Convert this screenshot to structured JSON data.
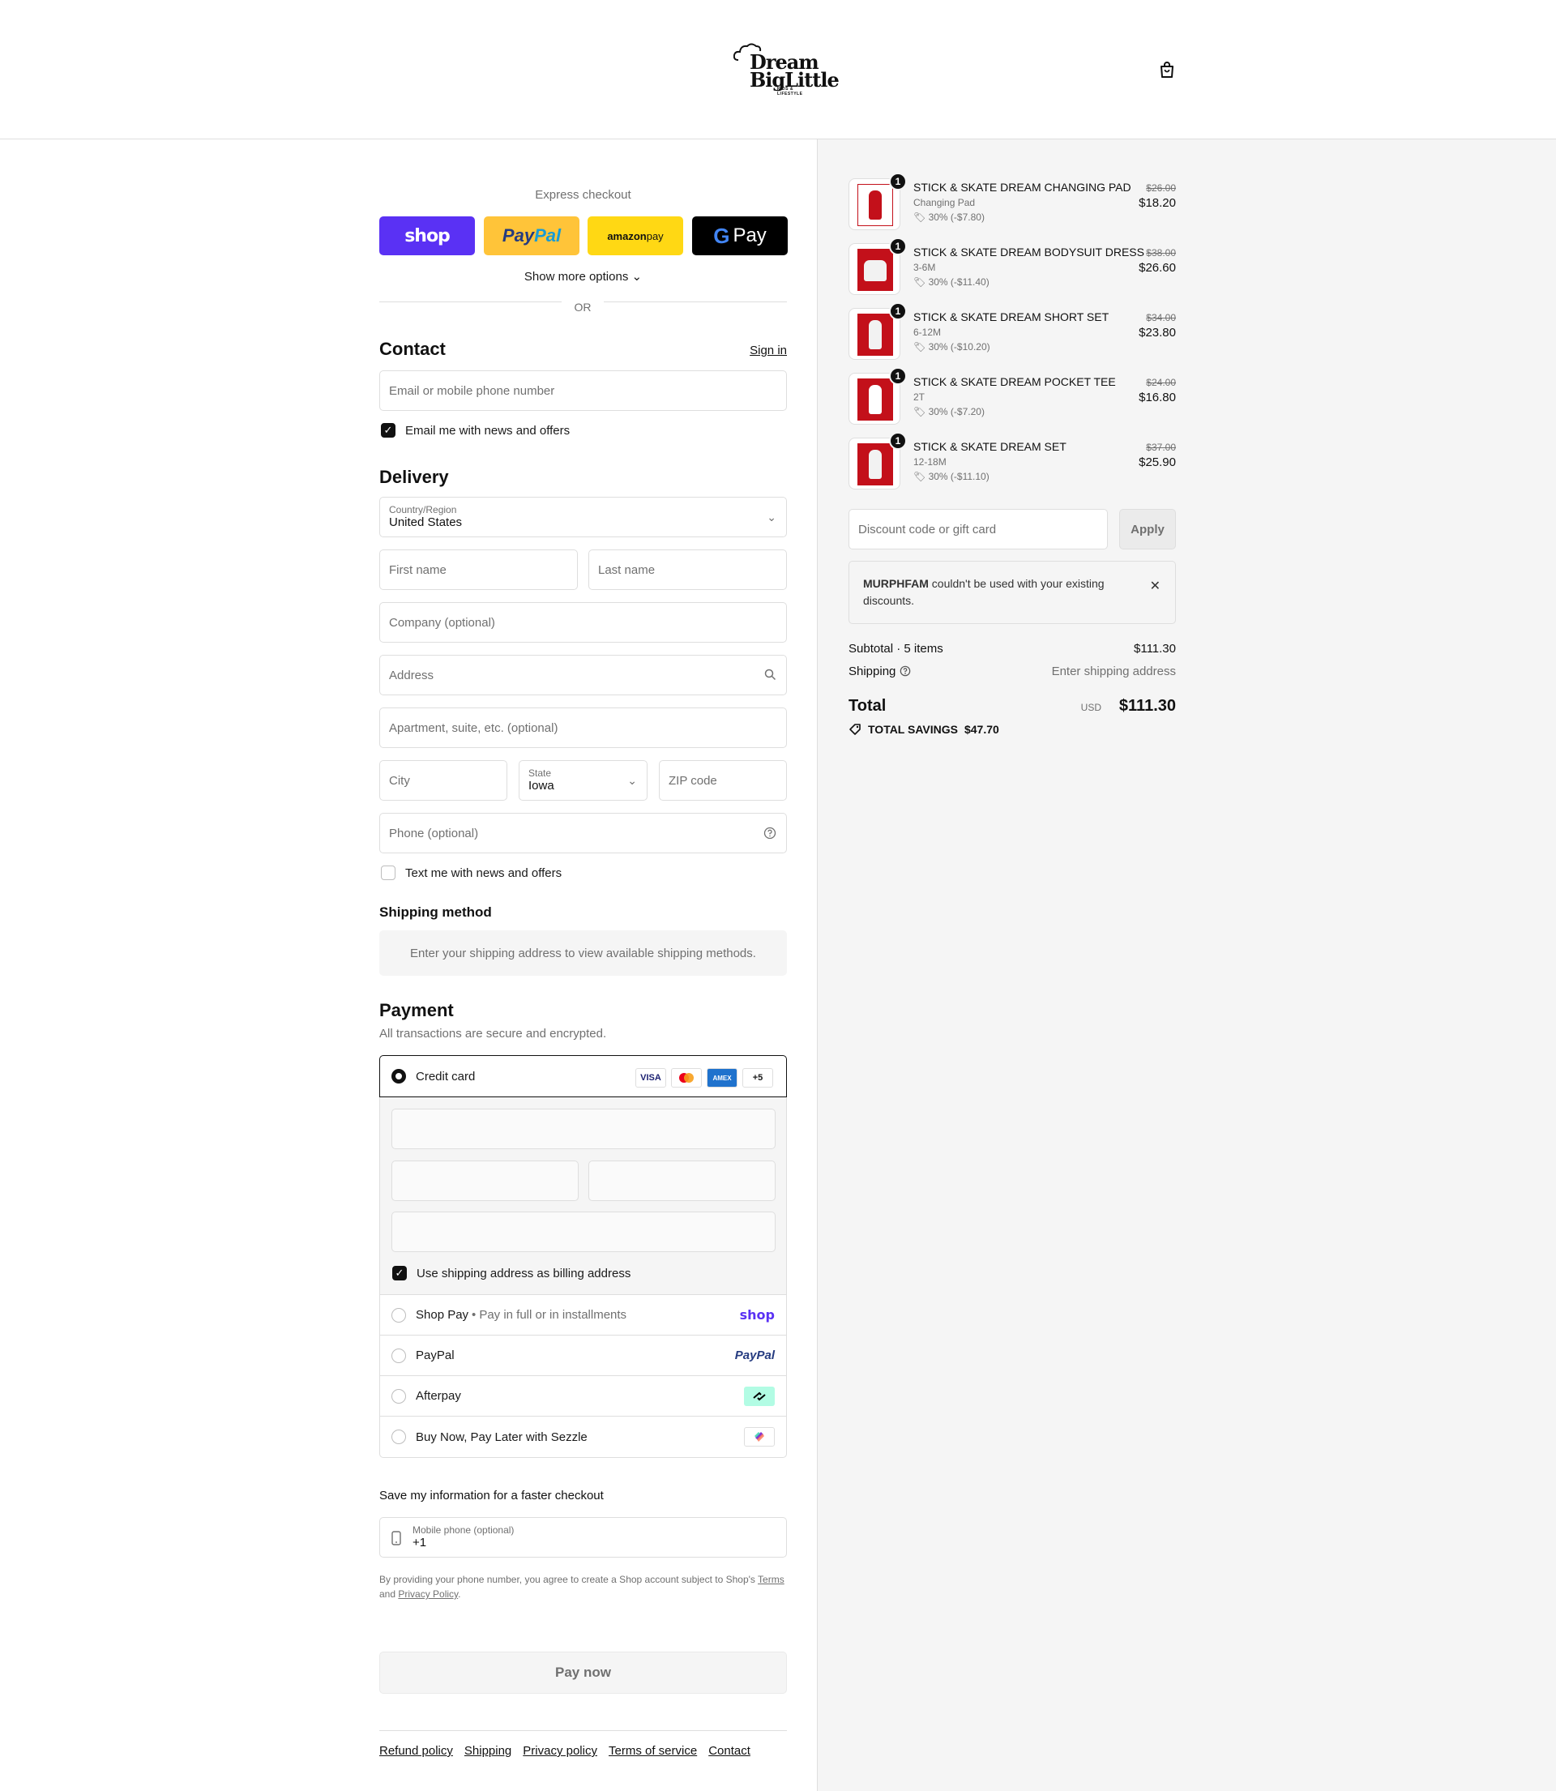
{
  "brand": {
    "logo_line1": "Dream",
    "logo_line2": "BigLittle",
    "logo_tagline": "KIDS & LIFESTYLE"
  },
  "express": {
    "title": "Express checkout",
    "shop_label": "shop",
    "paypal_label_a": "Pay",
    "paypal_label_b": "Pal",
    "amazon_label_a": "amazon",
    "amazon_label_b": " pay",
    "gpay_label": "Pay",
    "more_options": "Show more options",
    "or": "OR"
  },
  "contact": {
    "heading": "Contact",
    "sign_in": "Sign in",
    "email_placeholder": "Email or mobile phone number",
    "email_news": "Email me with news and offers"
  },
  "delivery": {
    "heading": "Delivery",
    "country_label": "Country/Region",
    "country_value": "United States",
    "first_name": "First name",
    "last_name": "Last name",
    "company": "Company (optional)",
    "address": "Address",
    "apartment": "Apartment, suite, etc. (optional)",
    "city": "City",
    "state_label": "State",
    "state_value": "Iowa",
    "zip": "ZIP code",
    "phone": "Phone (optional)",
    "text_news": "Text me with news and offers"
  },
  "shipping_method": {
    "heading": "Shipping method",
    "info": "Enter your shipping address to view available shipping methods."
  },
  "payment": {
    "heading": "Payment",
    "subtitle": "All transactions are secure and encrypted.",
    "credit_card": "Credit card",
    "card_more": "+5",
    "card_visa": "VISA",
    "card_amex": "AMEX",
    "billing_same": "Use shipping address as billing address",
    "shop_pay": "Shop Pay",
    "shop_pay_sub": "Pay in full or in installments",
    "shop_pay_logo": "shop",
    "paypal": "PayPal",
    "paypal_logo": "PayPal",
    "afterpay": "Afterpay",
    "sezzle": "Buy Now, Pay Later with Sezzle"
  },
  "save_info": {
    "title": "Save my information for a faster checkout",
    "phone_label": "Mobile phone (optional)",
    "phone_value": "+1",
    "legal_pre": "By providing your phone number, you agree to create a Shop account subject to Shop's",
    "legal_terms": "Terms",
    "legal_and": "and",
    "legal_privacy": "Privacy Policy",
    "legal_end": "."
  },
  "pay_now": "Pay now",
  "footer": [
    "Refund policy",
    "Shipping",
    "Privacy policy",
    "Terms of service",
    "Contact"
  ],
  "cart": {
    "items": [
      {
        "qty": "1",
        "name": "STICK & SKATE DREAM CHANGING PAD",
        "variant": "Changing Pad",
        "discount": "30% (-$7.80)",
        "original": "$26.00",
        "price": "$18.20"
      },
      {
        "qty": "1",
        "name": "STICK & SKATE DREAM BODYSUIT DRESS",
        "variant": "3-6M",
        "discount": "30% (-$11.40)",
        "original": "$38.00",
        "price": "$26.60"
      },
      {
        "qty": "1",
        "name": "STICK & SKATE DREAM SHORT SET",
        "variant": "6-12M",
        "discount": "30% (-$10.20)",
        "original": "$34.00",
        "price": "$23.80"
      },
      {
        "qty": "1",
        "name": "STICK & SKATE DREAM POCKET TEE",
        "variant": "2T",
        "discount": "30% (-$7.20)",
        "original": "$24.00",
        "price": "$16.80"
      },
      {
        "qty": "1",
        "name": "STICK & SKATE DREAM SET",
        "variant": "12-18M",
        "discount": "30% (-$11.10)",
        "original": "$37.00",
        "price": "$25.90"
      }
    ],
    "discount_placeholder": "Discount code or gift card",
    "apply": "Apply",
    "notice_code": "MURPHFAM",
    "notice_text": " couldn't be used with your existing discounts.",
    "subtotal_label": "Subtotal · 5 items",
    "subtotal_value": "$111.30",
    "shipping_label": "Shipping",
    "shipping_value": "Enter shipping address",
    "total_label": "Total",
    "currency": "USD",
    "total_value": "$111.30",
    "savings_label": "TOTAL SAVINGS",
    "savings_value": "$47.70"
  },
  "colors": {
    "shop_purple": "#5a31f4",
    "paypal_yellow": "#ffc439",
    "amazon_yellow": "#ffd814",
    "product_red": "#c3101a"
  }
}
